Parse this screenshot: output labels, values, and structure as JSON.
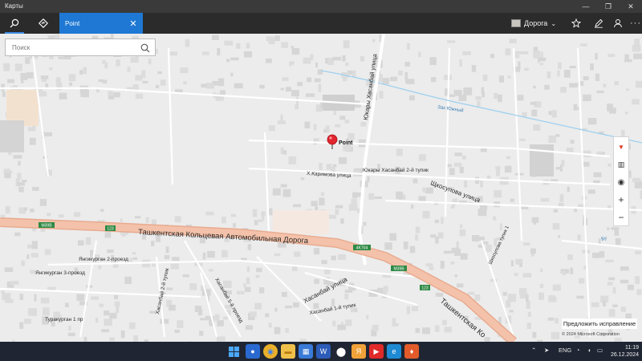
{
  "window": {
    "title": "Карты"
  },
  "appbar": {
    "active_tab": "Point",
    "view_mode": "Дорога"
  },
  "search": {
    "placeholder": "Поиск",
    "value": ""
  },
  "map": {
    "pin_label": "Point",
    "streets": {
      "yukary_khasanbay": "Юкары Хасанбай улица",
      "yukary_khasanbay_2": "Юкары Хасанбай 2-й тупик",
      "kh_karimova": "Х.Каримова улица",
      "shkosupova": "Щкосупова улица",
      "shkosupova_tupik": "Шкосупова тупик 1",
      "ring_road": "Ташкентская Кольцевая Автомобильная Дорога",
      "ring_road_2": "Ташкентская Ко",
      "yangikurgan_2": "Янгикурган 2-проезд",
      "yangikurgan_3": "Янгикурган 3-проезд",
      "turakurgan_1": "Туракурган 1 пр",
      "khasanbay": "Хасанбай улица",
      "khasanbay_1": "Хасанбай 1-й тупик",
      "khasanbay_2": "Хасанбай 2-й тупик",
      "khasanbay_5": "Хасанбай 5-й проезд",
      "canal": "Зах Южный",
      "canal_2": "Бу"
    },
    "shields": {
      "m39b_1": "M39B",
      "n123_1": "123",
      "r4k704": "4K704",
      "m39b_2": "M39B",
      "n123_2": "123"
    }
  },
  "suggest_button": "Предложить исправление",
  "copyright": "© 2024 Microsoft Corporation",
  "taskbar": {
    "lang": "ENG",
    "time": "11:19",
    "date": "26.12.2024"
  },
  "colors": {
    "accent": "#1e78d4",
    "highway": "#f0b9a0",
    "pin": "#e0262e"
  }
}
